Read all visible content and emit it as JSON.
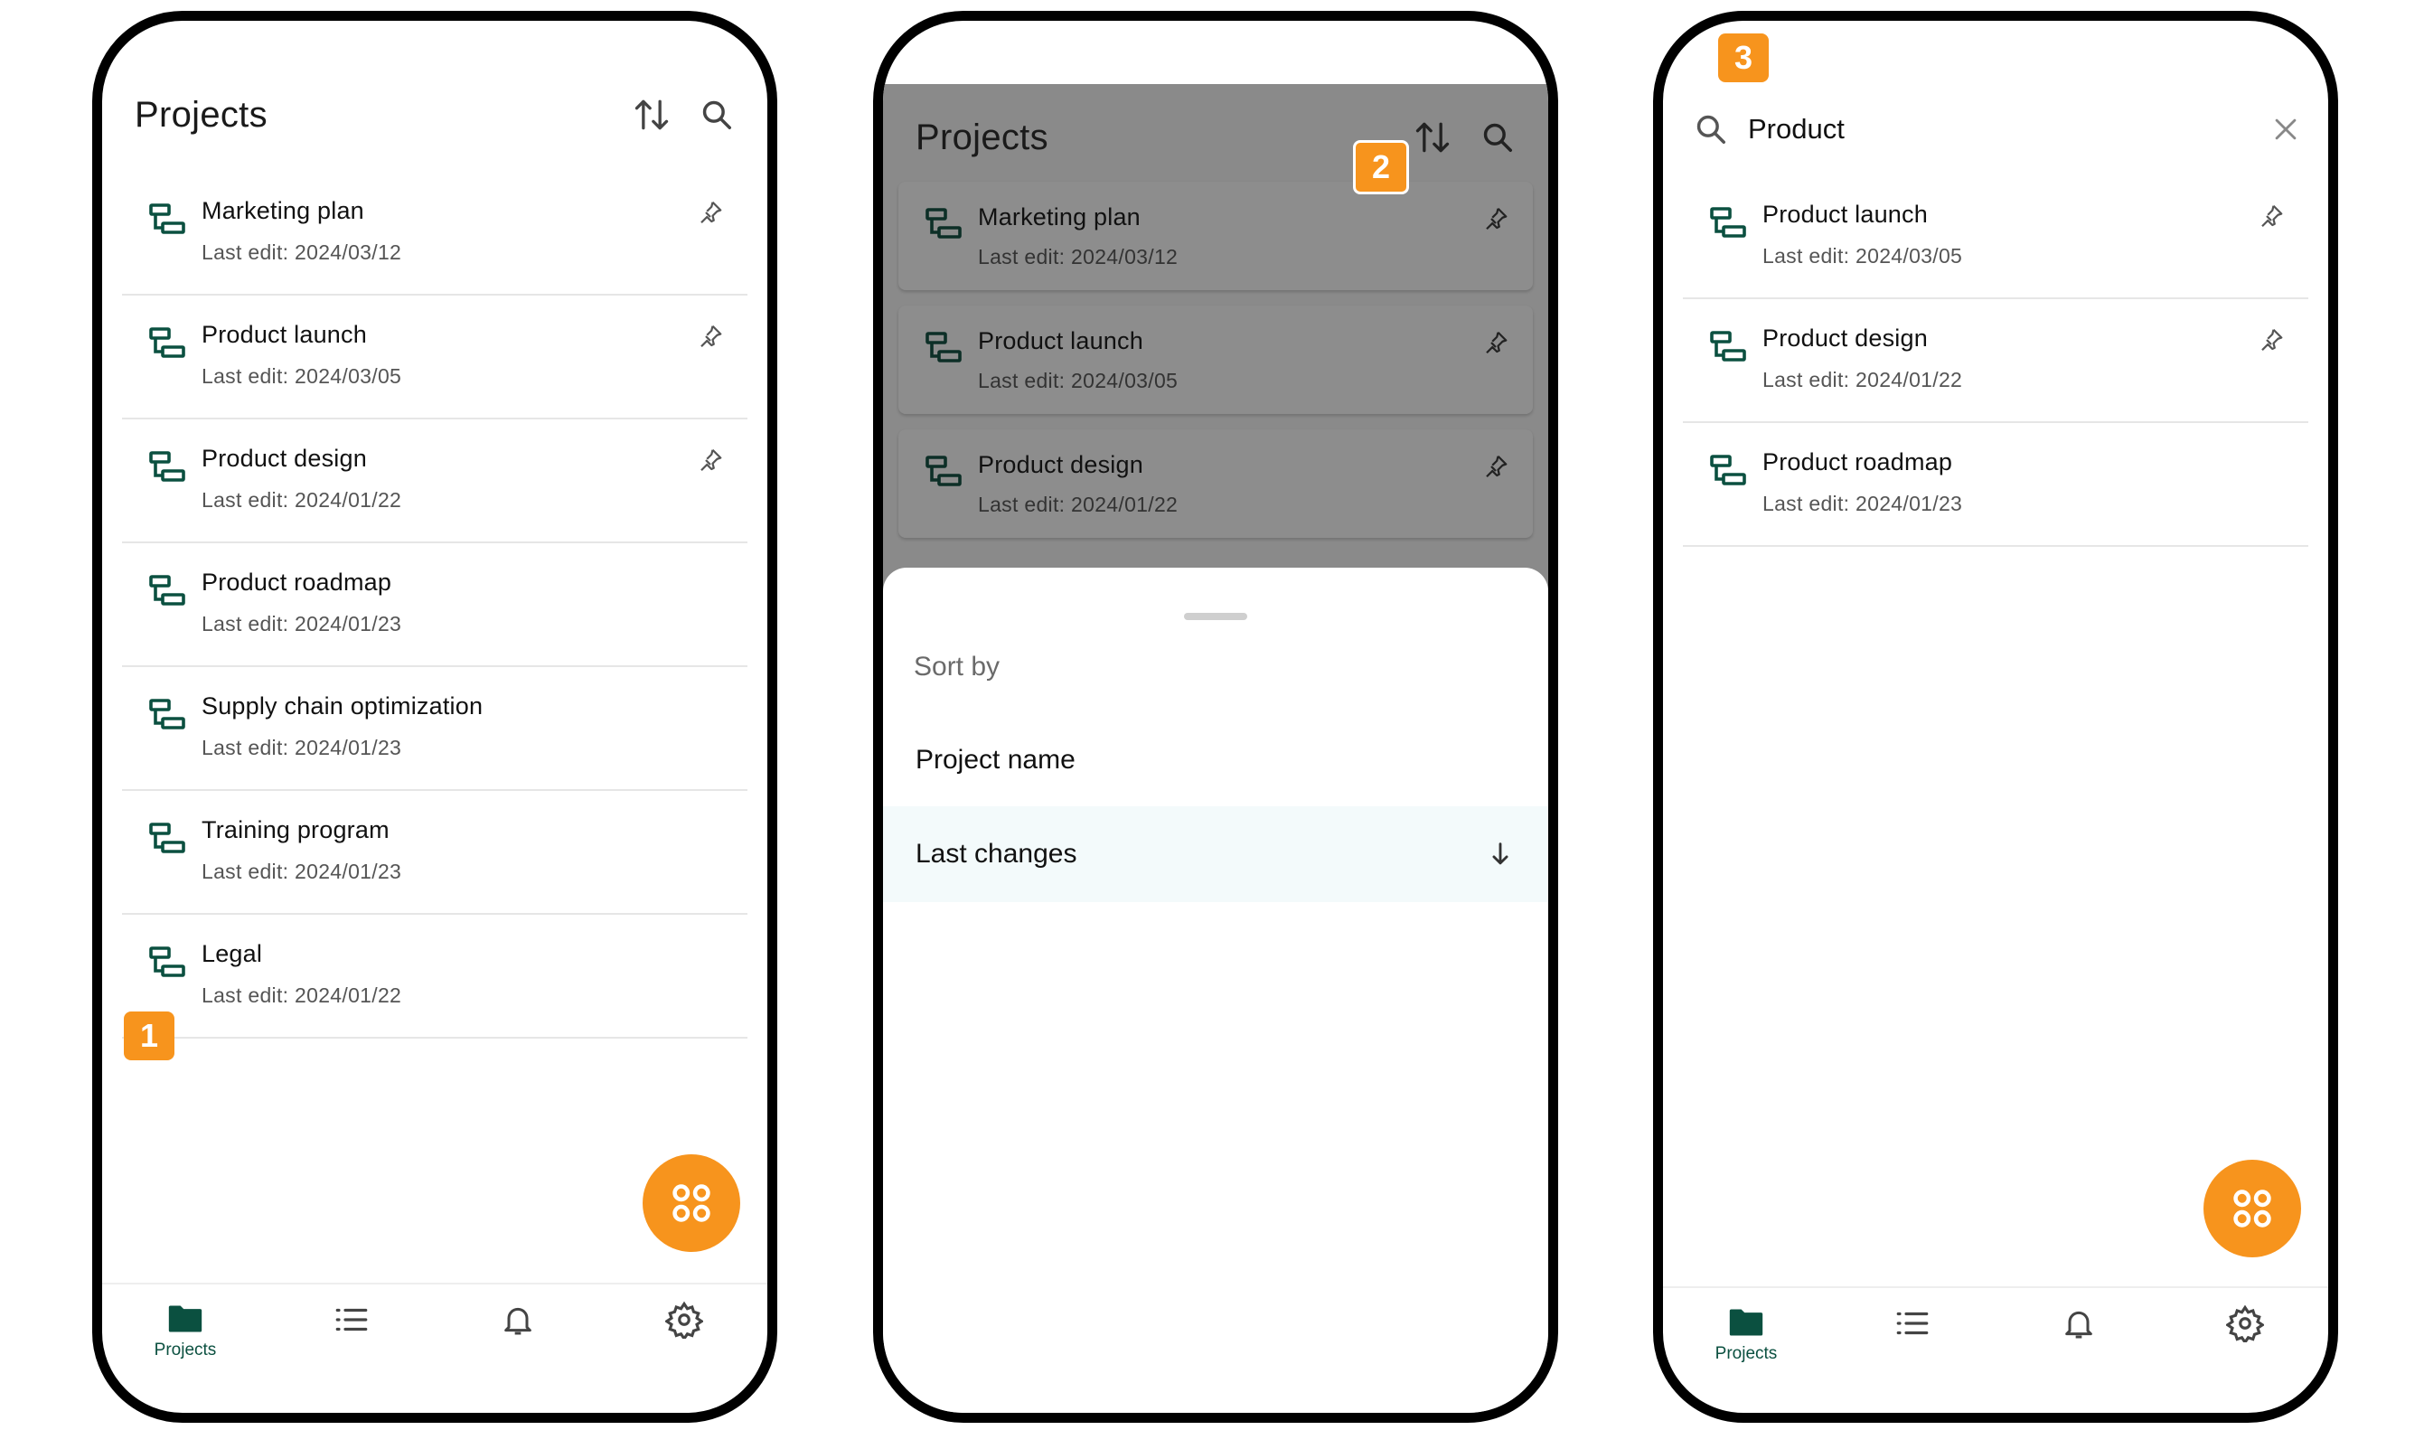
{
  "phone1": {
    "title": "Projects",
    "projects": [
      {
        "name": "Marketing plan",
        "last_edit": "Last edit: 2024/03/12",
        "pinned": true
      },
      {
        "name": "Product launch",
        "last_edit": "Last edit: 2024/03/05",
        "pinned": true
      },
      {
        "name": "Product design",
        "last_edit": "Last edit: 2024/01/22",
        "pinned": true
      },
      {
        "name": "Product roadmap",
        "last_edit": "Last edit: 2024/01/23",
        "pinned": false
      },
      {
        "name": "Supply chain optimization",
        "last_edit": "Last edit: 2024/01/23",
        "pinned": false
      },
      {
        "name": "Training program",
        "last_edit": "Last edit: 2024/01/23",
        "pinned": false
      },
      {
        "name": "Legal",
        "last_edit": "Last edit: 2024/01/22",
        "pinned": false
      }
    ],
    "nav": {
      "projects_label": "Projects"
    }
  },
  "phone2": {
    "title": "Projects",
    "projects": [
      {
        "name": "Marketing plan",
        "last_edit": "Last edit: 2024/03/12"
      },
      {
        "name": "Product launch",
        "last_edit": "Last edit: 2024/03/05"
      },
      {
        "name": "Product design",
        "last_edit": "Last edit: 2024/01/22"
      }
    ],
    "sort_sheet": {
      "title": "Sort by",
      "options": [
        "Project name",
        "Last changes"
      ],
      "selected": "Last changes",
      "direction": "descending"
    }
  },
  "phone3": {
    "search_value": "Product",
    "projects": [
      {
        "name": "Product launch",
        "last_edit": "Last edit: 2024/03/05",
        "pinned": true
      },
      {
        "name": "Product design",
        "last_edit": "Last edit: 2024/01/22",
        "pinned": true
      },
      {
        "name": "Product roadmap",
        "last_edit": "Last edit: 2024/01/23",
        "pinned": false
      }
    ],
    "nav": {
      "projects_label": "Projects"
    }
  },
  "badges": [
    "1",
    "2",
    "3"
  ],
  "colors": {
    "accent": "#f7941d",
    "brand_green": "#0b5040",
    "dim_overlay": "#8a8a8a"
  },
  "icons": [
    "project-icon",
    "pin-icon",
    "sort-icon",
    "search-icon",
    "close-icon",
    "apps-icon",
    "folder-icon",
    "list-icon",
    "bell-icon",
    "gear-icon",
    "arrow-down-icon"
  ]
}
